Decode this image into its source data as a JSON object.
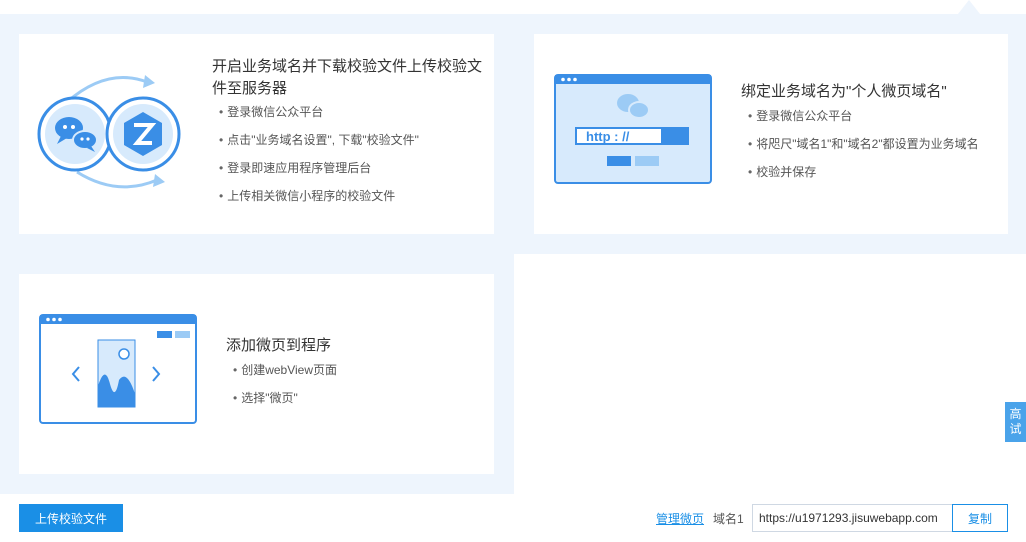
{
  "cards": [
    {
      "title_line1": "开启业务域名并下载校验文件上传校验文",
      "title_line2": "件至服务器",
      "bullets": [
        "登录微信公众平台",
        "点击\"业务域名设置\", 下载\"校验文件\"",
        "登录即速应用程序管理后台",
        "上传相关微信小程序的校验文件"
      ]
    },
    {
      "title": "绑定业务域名为\"个人微页域名\"",
      "bullets": [
        "登录微信公众平台",
        "将咫尺\"域名1\"和\"域名2\"都设置为业务域名",
        "校验并保存"
      ],
      "url_text": "http : //"
    },
    {
      "title": "添加微页到程序",
      "bullets": [
        "创建webView页面",
        "选择\"微页\""
      ]
    }
  ],
  "footer": {
    "upload_button": "上传校验文件",
    "manage_link": "管理微页",
    "domain_label": "域名1",
    "domain_value": "https://u1971293.jisuwebapp.com",
    "copy_button": "复制"
  },
  "side_tab": {
    "line1": "高",
    "line2": "试"
  },
  "colors": {
    "accent": "#1a8fe6",
    "panel_bg": "#eef5fd",
    "illus_blue": "#3a8ee6",
    "illus_light": "#d7eafc"
  }
}
